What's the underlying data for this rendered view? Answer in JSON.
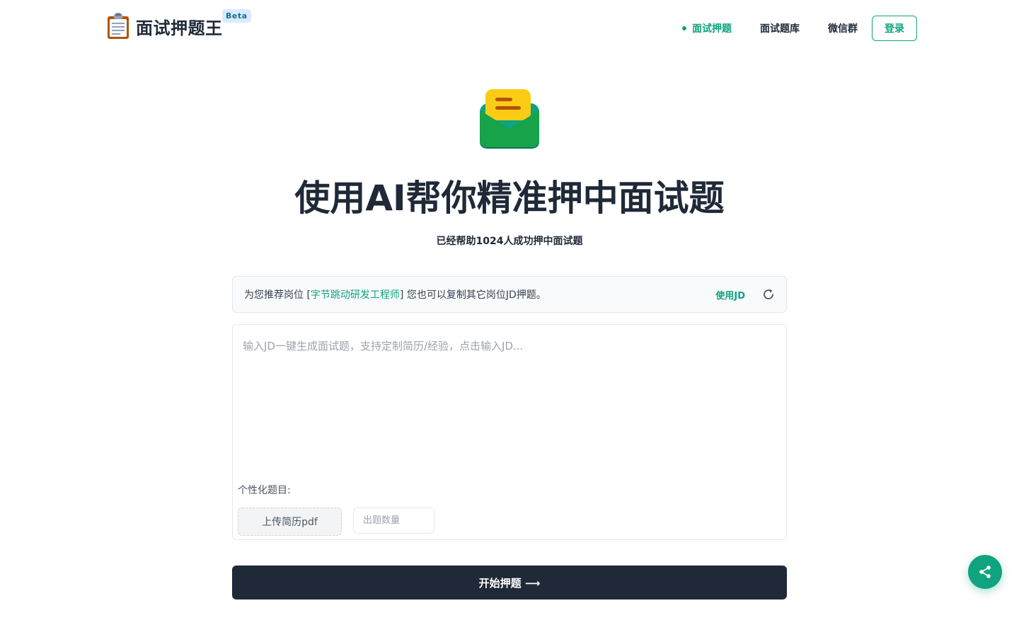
{
  "header": {
    "logo_text": "面试押题王",
    "beta_badge": "Beta",
    "nav": [
      {
        "label": "面试押题",
        "active": true
      },
      {
        "label": "面试题库",
        "active": false
      },
      {
        "label": "微信群",
        "active": false
      }
    ],
    "login_label": "登录"
  },
  "hero": {
    "title": "使用AI帮你精准押中面试题",
    "subtitle": "已经帮助1024人成功押中面试题"
  },
  "suggestion": {
    "prefix": "为您推荐岗位 [",
    "job": "字节跳动研发工程师",
    "suffix": "] 您也可以复制其它岗位JD押题。",
    "use_jd_label": "使用JD"
  },
  "input_card": {
    "jd_placeholder": "输入JD一键生成面试题，支持定制简历/经验，点击输入JD...",
    "custom_label": "个性化题目:",
    "upload_label": "上传简历pdf",
    "count_placeholder": "出题数量"
  },
  "start_button": {
    "label": "开始押题 ⟶"
  },
  "colors": {
    "accent": "#10a37f",
    "dark": "#1f2937",
    "muted": "#9ca3af"
  },
  "icons": {
    "logo": "clipboard-icon",
    "hero": "envelope-letter-icon",
    "refresh": "refresh-icon",
    "share": "share-icon"
  }
}
